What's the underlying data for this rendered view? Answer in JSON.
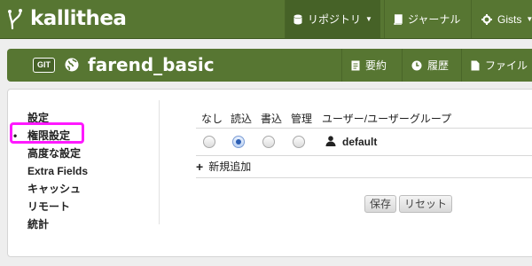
{
  "app": {
    "logo_text": "kallithea"
  },
  "topnav": {
    "repositories": "リポジトリ",
    "journal": "ジャーナル",
    "gists": "Gists"
  },
  "repo": {
    "type_badge": "GIT",
    "name": "farend_basic",
    "actions": {
      "summary": "要約",
      "history": "履歴",
      "files": "ファイル"
    }
  },
  "sidebar": {
    "items": [
      {
        "label": "設定"
      },
      {
        "label": "権限設定"
      },
      {
        "label": "高度な設定"
      },
      {
        "label": "Extra Fields"
      },
      {
        "label": "キャッシュ"
      },
      {
        "label": "リモート"
      },
      {
        "label": "統計"
      }
    ],
    "active_index": 1
  },
  "permissions": {
    "headers": {
      "none": "なし",
      "read": "読込",
      "write": "書込",
      "admin": "管理",
      "user_group": "ユーザー/ユーザーグループ"
    },
    "rows": [
      {
        "name": "default",
        "selected": "read"
      }
    ],
    "add_label": "新規追加"
  },
  "buttons": {
    "save": "保存",
    "reset": "リセット"
  },
  "colors": {
    "brand": "#577632",
    "highlight": "#ff19ff"
  }
}
